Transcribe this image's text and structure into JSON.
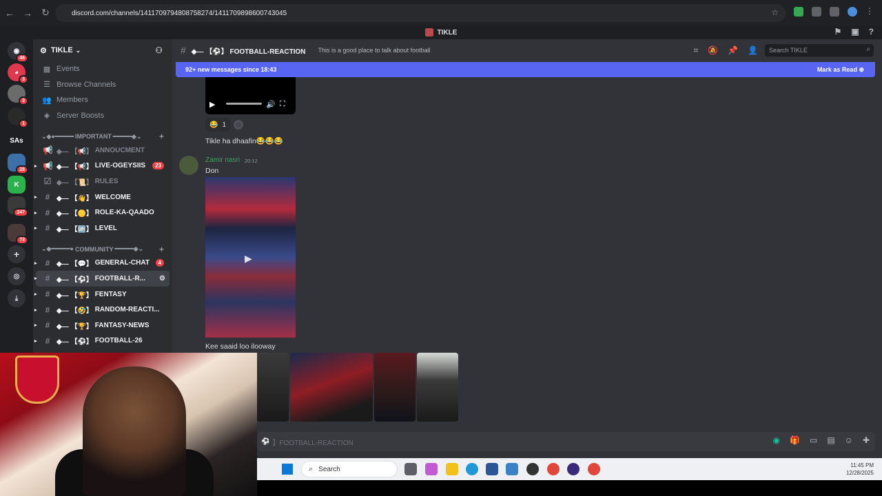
{
  "browser": {
    "url": "discord.com/channels/1411709794808758274/1411709898600743045"
  },
  "window": {
    "title": "TIKLE"
  },
  "server_rail": {
    "badges": [
      "46",
      "3",
      "3",
      "1",
      "28",
      "247",
      "73"
    ],
    "text_server": "SAs"
  },
  "sidebar": {
    "guild_name": "TIKLE",
    "menu": [
      {
        "label": "Events"
      },
      {
        "label": "Browse Channels"
      },
      {
        "label": "Members"
      },
      {
        "label": "Server Boosts"
      }
    ],
    "categories": [
      {
        "label": "IMPORTANT"
      },
      {
        "label": "COMMUNITY"
      }
    ],
    "important_channels": [
      {
        "prefix": "◆— 【📢】",
        "name": "ANNOUCMENT",
        "badge": ""
      },
      {
        "prefix": "◆— 【📢】",
        "name": "LIVE-OGEYSIIS",
        "badge": "23"
      },
      {
        "prefix": "◆— 【📜】",
        "name": "RULES",
        "badge": ""
      },
      {
        "prefix": "◆— 【👋】",
        "name": "WELCOME",
        "badge": ""
      },
      {
        "prefix": "◆— 【🟡】",
        "name": "ROLE-KA-QAADO",
        "badge": ""
      },
      {
        "prefix": "◆— 【🆙】",
        "name": "LEVEL",
        "badge": ""
      }
    ],
    "community_channels": [
      {
        "prefix": "◆— 【💬】",
        "name": "GENERAL-CHAT",
        "badge": "4"
      },
      {
        "prefix": "◆— 【⚽】",
        "name": "FOOTBALL-R...",
        "badge": ""
      },
      {
        "prefix": "◆— 【🏆】",
        "name": "FENTASY",
        "badge": ""
      },
      {
        "prefix": "◆— 【🤣】",
        "name": "RANDOM-REACTI...",
        "badge": ""
      },
      {
        "prefix": "◆— 【🏆】",
        "name": "FANTASY-NEWS",
        "badge": ""
      },
      {
        "prefix": "◆— 【⚽】",
        "name": "FOOTBALL-26",
        "badge": ""
      }
    ]
  },
  "channel_header": {
    "name": "◆— 【⚽】 FOOTBALL-REACTION",
    "topic": "This is a good place to talk about football",
    "search_placeholder": "Search TIKLE"
  },
  "new_messages_bar": {
    "text": "92+ new messages since 18:43",
    "action": "Mark as Read"
  },
  "messages": {
    "reaction_emoji": "😂",
    "reaction_count": "1",
    "first_text": "Tikle ha dhaafin😂😂😂",
    "author": "Zamir nasri",
    "timestamp": "20:12",
    "second_text": "Don",
    "third_text": "Kee saaid loo ilooway"
  },
  "composer": {
    "placeholder": "】FOOTBALL-REACTION"
  },
  "taskbar": {
    "search": "Search",
    "time": "11:45 PM",
    "date": "12/28/2025"
  },
  "colors": {
    "blurple": "#5865f2",
    "unread_badge": "#f23f43",
    "author_green": "#3ba55d"
  }
}
